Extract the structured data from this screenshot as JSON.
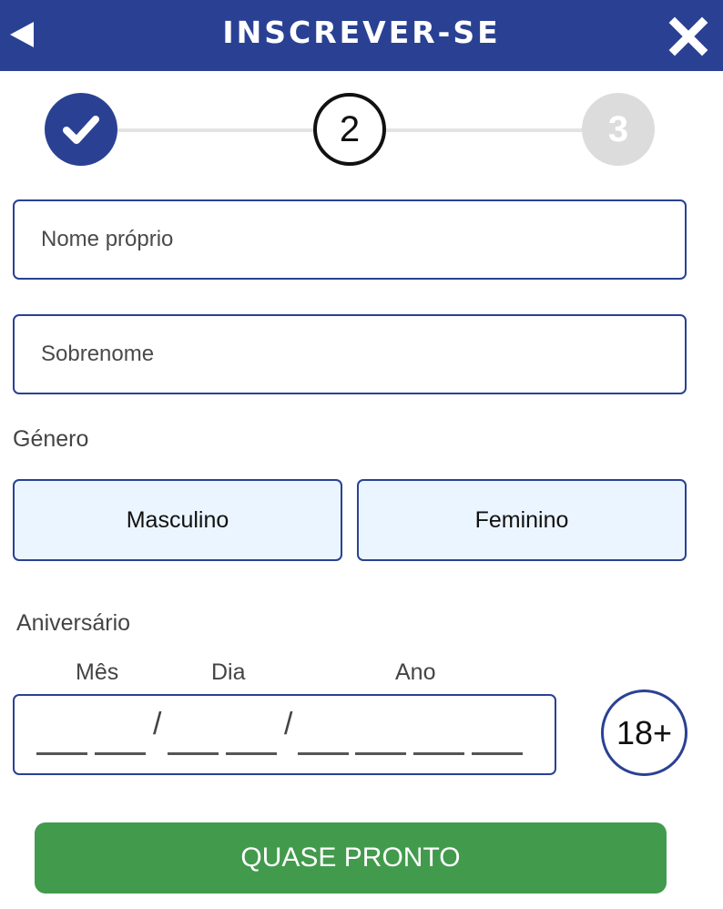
{
  "header": {
    "title": "INSCREVER-SE",
    "back_icon": "back-arrow-icon",
    "close_icon": "close-icon"
  },
  "steps": [
    {
      "label": "",
      "state": "completed",
      "icon": "checkmark-icon"
    },
    {
      "label": "2",
      "state": "current"
    },
    {
      "label": "3",
      "state": "pending"
    }
  ],
  "form": {
    "first_name": {
      "placeholder": "Nome próprio",
      "value": ""
    },
    "last_name": {
      "placeholder": "Sobrenome",
      "value": ""
    },
    "gender": {
      "label": "Género",
      "options": [
        "Masculino",
        "Feminino"
      ]
    },
    "birthday": {
      "label": "Aniversário",
      "month_label": "Mês",
      "day_label": "Dia",
      "year_label": "Ano",
      "separator": "/",
      "age_badge": "18+"
    }
  },
  "submit_label": "QUASE PRONTO",
  "colors": {
    "primary": "#2a4193",
    "success": "#429a4d",
    "option_bg": "#ebf5ff",
    "inactive": "#dcdcdc"
  }
}
